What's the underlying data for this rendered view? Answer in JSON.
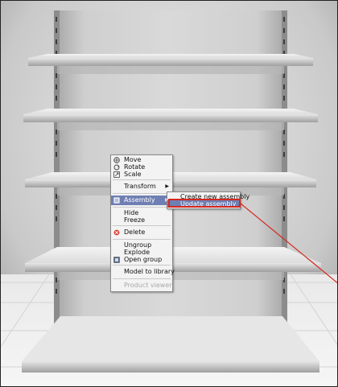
{
  "context_menu": {
    "items": [
      {
        "label": "Move",
        "icon": "move-icon"
      },
      {
        "label": "Rotate",
        "icon": "rotate-icon"
      },
      {
        "label": "Scale",
        "icon": "scale-icon"
      },
      {
        "label": "Transform",
        "has_submenu": true
      },
      {
        "label": "Assembly",
        "icon": "assembly-icon",
        "has_submenu": true,
        "selected": true
      },
      {
        "label": "Hide"
      },
      {
        "label": "Freeze"
      },
      {
        "label": "Delete",
        "icon": "delete-icon"
      },
      {
        "label": "Ungroup"
      },
      {
        "label": "Explode"
      },
      {
        "label": "Open group",
        "icon": "open-group-icon"
      },
      {
        "label": "Model to library"
      },
      {
        "label": "Product viewer",
        "disabled": true
      }
    ]
  },
  "submenu": {
    "items": [
      {
        "label": "Create new assembly"
      },
      {
        "label": "Update assembly",
        "selected": true
      }
    ]
  },
  "colors": {
    "selection": "#6f7fb3",
    "callout": "#d5271f"
  }
}
